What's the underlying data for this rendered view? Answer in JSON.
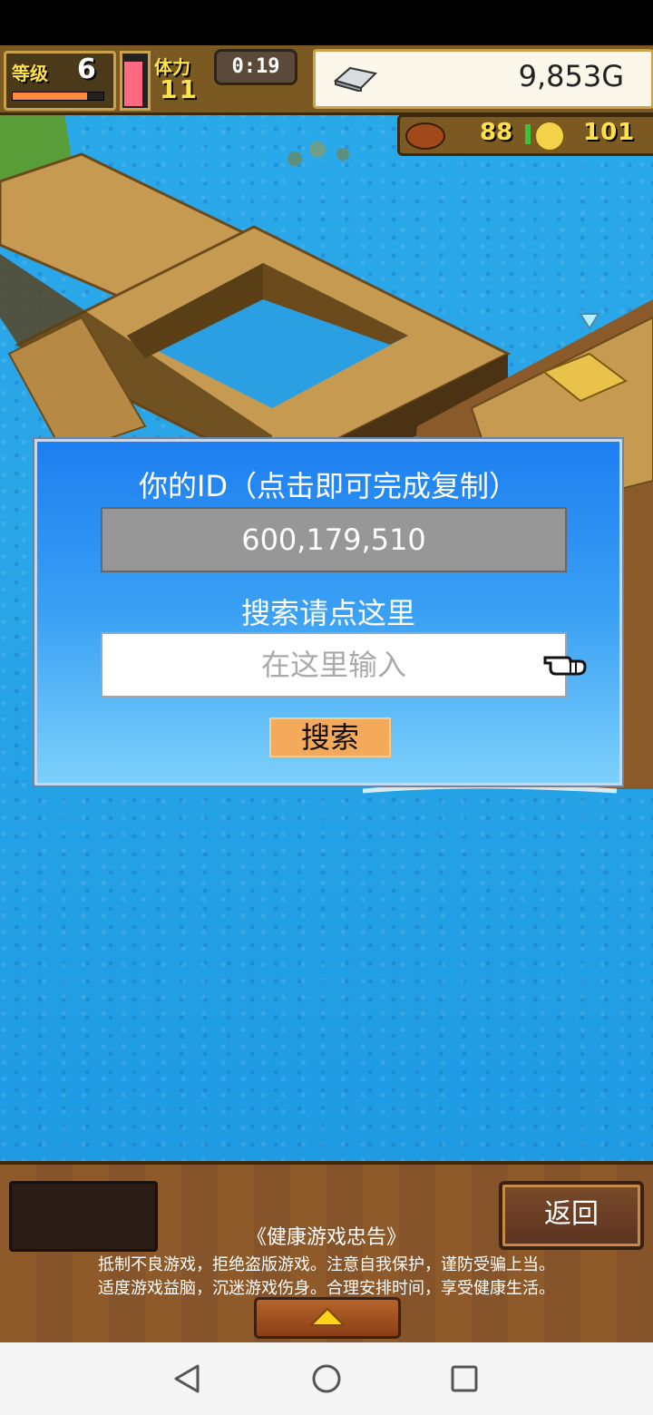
{
  "hud": {
    "level_label": "等级",
    "level_value": "6",
    "level_progress": 0.82,
    "stamina_level": 0.9,
    "stamina_label": "体力",
    "stamina_value": "11",
    "timer": "0:19",
    "gold_icon": "silver-bar-icon",
    "gold": "9,853G"
  },
  "resources": {
    "food_icon": "roast-meat-icon",
    "food_value": "88",
    "coin_icon": "gold-coin-icon",
    "coin_value": "101"
  },
  "dialog": {
    "id_label": "你的ID（点击即可完成复制）",
    "id_value": "600,179,510",
    "search_label": "搜索请点这里",
    "search_placeholder": "在这里输入",
    "search_button": "搜索",
    "pointer_icon": "pointing-hand-icon"
  },
  "bottom": {
    "back_button": "返回",
    "notice_title": "《健康游戏忠告》",
    "notice_line1": "抵制不良游戏，拒绝盗版游戏。注意自我保护，谨防受骗上当。",
    "notice_line2": "适度游戏益脑，沉迷游戏伤身。合理安排时间，享受健康生活。",
    "expand_icon": "up-arrow-icon"
  },
  "nav": {
    "back_icon": "triangle-back-icon",
    "home_icon": "circle-home-icon",
    "recents_icon": "square-recents-icon"
  },
  "colors": {
    "ocean": "#29a8ea",
    "dialog_top": "#1d7ff0",
    "dialog_bottom": "#7cd0fb",
    "search_button": "#f5a95a",
    "hud_wood": "#7a5a22",
    "text_yellow": "#ffe14a"
  }
}
